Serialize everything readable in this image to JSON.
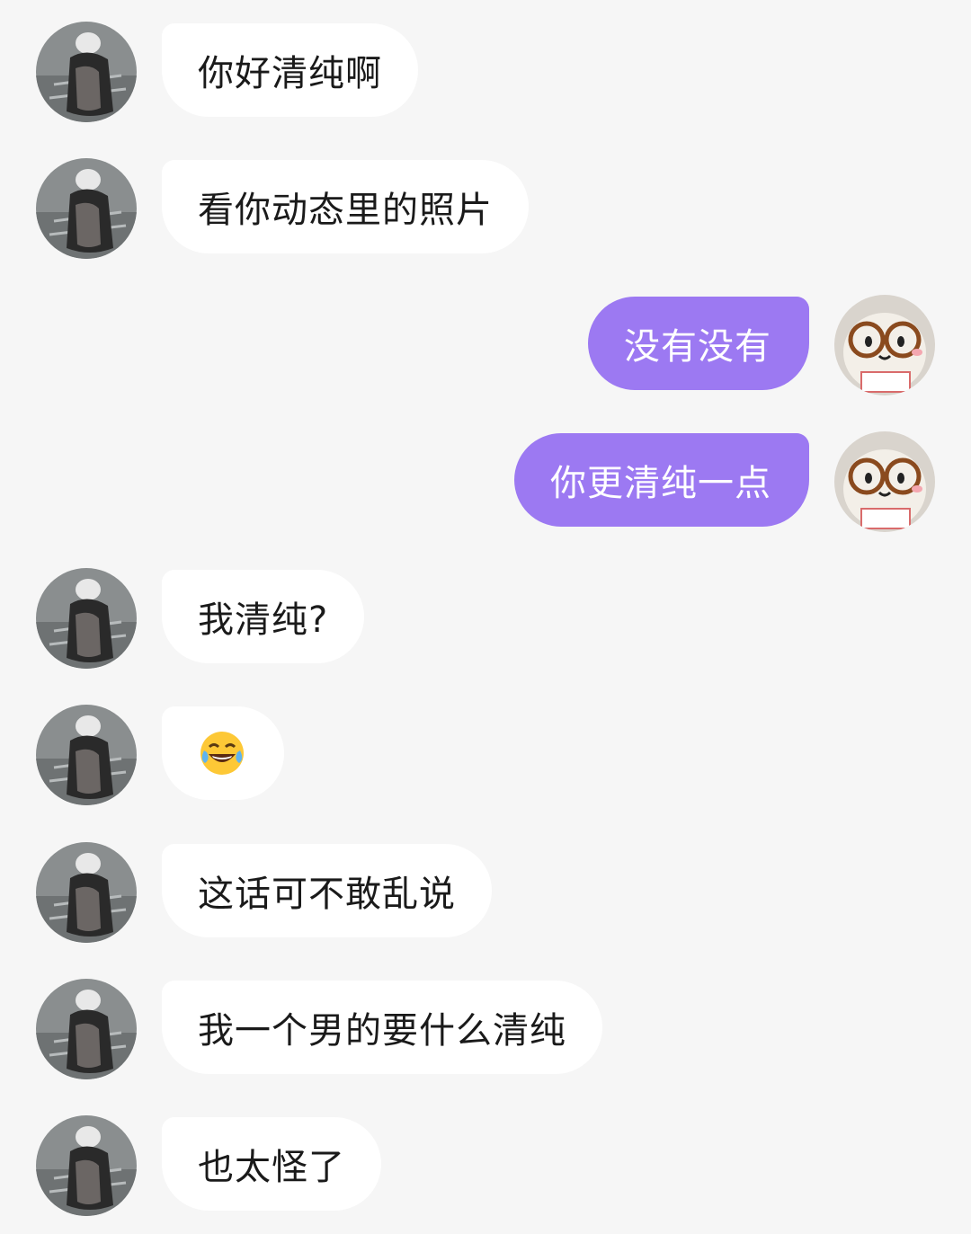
{
  "chat": {
    "messages": [
      {
        "side": "in",
        "text": "你好清纯啊"
      },
      {
        "side": "in",
        "text": "看你动态里的照片"
      },
      {
        "side": "out",
        "text": "没有没有"
      },
      {
        "side": "out",
        "text": "你更清纯一点"
      },
      {
        "side": "in",
        "text": "我清纯?"
      },
      {
        "side": "in",
        "text": "",
        "emoji": "laughing-tears-emoji"
      },
      {
        "side": "in",
        "text": "这话可不敢乱说"
      },
      {
        "side": "in",
        "text": "我一个男的要什么清纯"
      },
      {
        "side": "in",
        "text": "也太怪了"
      }
    ]
  },
  "colors": {
    "background": "#f6f6f6",
    "incoming_bubble": "#ffffff",
    "outgoing_bubble": "#9c79f2",
    "incoming_text": "#1a1a1a",
    "outgoing_text": "#ffffff"
  }
}
